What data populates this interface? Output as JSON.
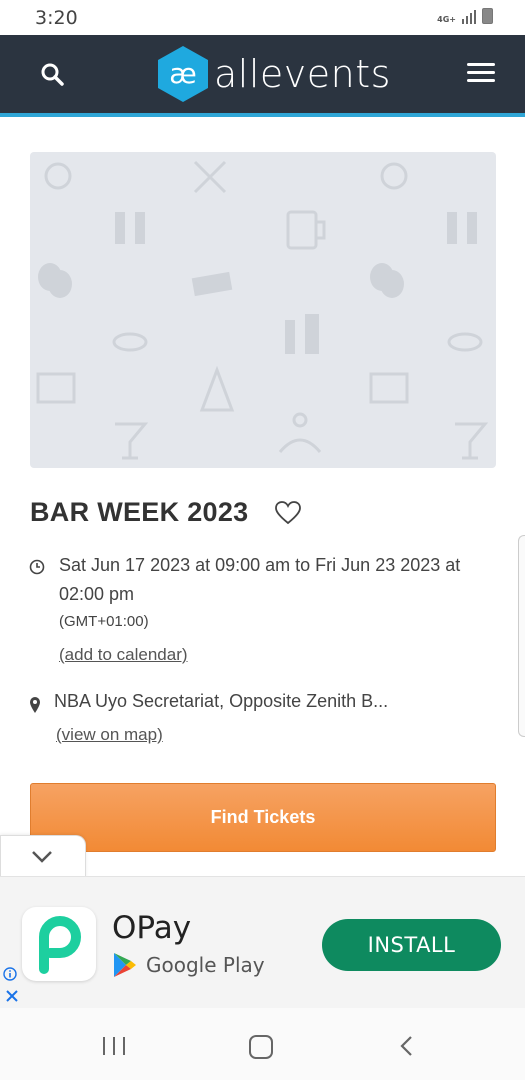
{
  "status_bar": {
    "time": "3:20",
    "network": "4G+"
  },
  "header": {
    "logo_text": "allevents",
    "logo_mark": "æ"
  },
  "event": {
    "title": "BAR WEEK 2023",
    "date_range": "Sat Jun 17 2023 at 09:00 am to Fri Jun 23 2023 at 02:00 pm",
    "timezone": "(GMT+01:00)",
    "add_to_calendar": "(add to calendar)",
    "venue": "NBA Uyo Secretariat, Opposite Zenith B...",
    "view_on_map": "(view on map)",
    "find_tickets": "Find Tickets"
  },
  "ad": {
    "app_name": "OPay",
    "store": "Google Play",
    "install": "INSTALL",
    "brand_color": "#1dcf9f",
    "button_color": "#0e8a5f"
  },
  "colors": {
    "header_bg": "#2b3440",
    "accent": "#2fa6d6",
    "cta": "#f28a35"
  }
}
